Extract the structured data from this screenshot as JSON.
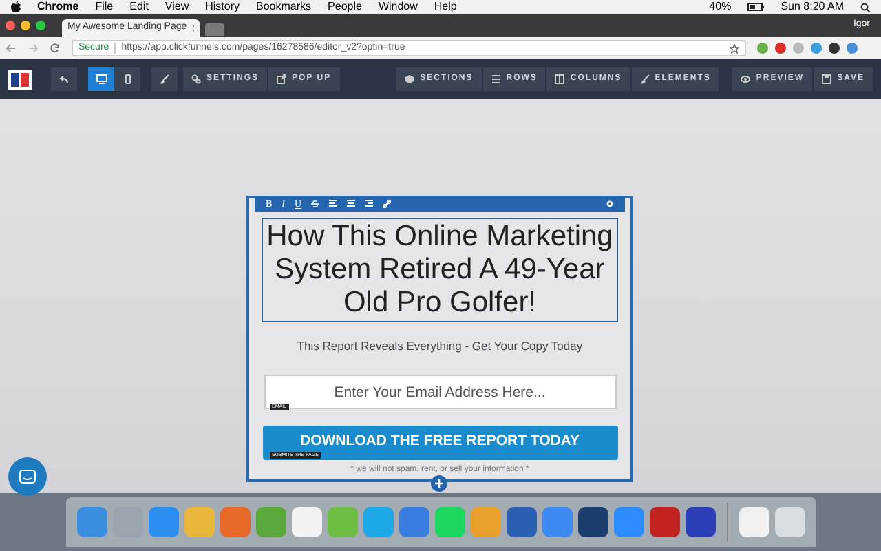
{
  "menu_bar": {
    "app": "Chrome",
    "items": [
      "File",
      "Edit",
      "View",
      "History",
      "Bookmarks",
      "People",
      "Window",
      "Help"
    ],
    "battery": "40%",
    "clock": "Sun 8:20 AM"
  },
  "browser": {
    "tab_title": "My Awesome Landing Page",
    "user": "Igor",
    "secure_label": "Secure",
    "url": "https://app.clickfunnels.com/pages/16278586/editor_v2?optin=true"
  },
  "toolbar": {
    "devices": [
      {
        "kind": "desktop",
        "selected": true
      },
      {
        "kind": "mobile",
        "selected": false
      }
    ],
    "left_buttons": [
      {
        "kind": "settings",
        "label": "SETTINGS"
      },
      {
        "kind": "popup",
        "label": "POP UP"
      }
    ],
    "right_buttons": [
      {
        "kind": "sections",
        "label": "SECTIONS"
      },
      {
        "kind": "rows",
        "label": "ROWS"
      },
      {
        "kind": "columns",
        "label": "COLUMNS"
      },
      {
        "kind": "elements",
        "label": "ELEMENTS"
      }
    ],
    "action_buttons": [
      {
        "kind": "preview",
        "label": "PREVIEW"
      },
      {
        "kind": "save",
        "label": "SAVE"
      }
    ]
  },
  "editor": {
    "format_buttons": [
      "B",
      "I",
      "U"
    ],
    "headline": "How This Online Marketing System Retired A 49-Year Old Pro Golfer!",
    "subheadline": "This Report Reveals Everything - Get Your Copy Today",
    "email_placeholder": "Enter Your Email Address Here...",
    "email_tag": "EMAIL",
    "cta": "DOWNLOAD THE FREE REPORT TODAY",
    "cta_tag": "SUBMITS THE PAGE",
    "disclaimer": "* we will not spam, rent, or sell your information *"
  },
  "dock": {
    "apps": [
      {
        "color": "#3b8de0"
      },
      {
        "color": "#9aa4ad"
      },
      {
        "color": "#2a8ff0"
      },
      {
        "color": "#e8b73a"
      },
      {
        "color": "#e8692a"
      },
      {
        "color": "#5aa83c"
      },
      {
        "color": "#f2f2f2"
      },
      {
        "color": "#6fbe44"
      },
      {
        "color": "#1ea8e8"
      },
      {
        "color": "#3a7de0"
      },
      {
        "color": "#1ed760"
      },
      {
        "color": "#e8a02a"
      },
      {
        "color": "#2b5fb4"
      },
      {
        "color": "#3d8bf2"
      },
      {
        "color": "#1a3d6e"
      },
      {
        "color": "#2d8cff"
      },
      {
        "color": "#c0231f"
      },
      {
        "color": "#2c3fb8"
      },
      {
        "color": "#f0f0f0"
      },
      {
        "color": "#d8dde2"
      }
    ]
  }
}
